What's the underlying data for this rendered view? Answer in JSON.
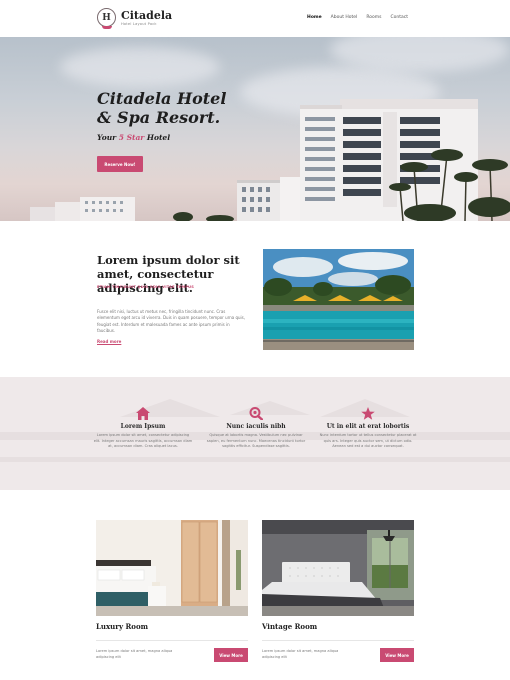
{
  "header": {
    "logo_letter": "H",
    "brand": "Citadela",
    "tagline": "Hotel Layout Pack",
    "nav": [
      "Home",
      "About Hotel",
      "Rooms",
      "Contact"
    ]
  },
  "hero": {
    "title_line1": "Citadela Hotel",
    "title_line2": "& Spa Resort.",
    "subtitle_pre": "Your ",
    "subtitle_accent": "5 Star",
    "subtitle_post": " Hotel",
    "button": "Reserve Now!"
  },
  "about": {
    "title": "Lorem ipsum dolor sit amet, consectetur adipiscing elit.",
    "kicker": "ETIAM TINCIDUNT QUIS ODIO VITAE TEMPUS",
    "body": "Fusce elit nisi, luctus ut metus nec, fringilla tincidunt nunc. Cras elementum eget arcu id viverra. Duis in quam posuere, tempor urna quis, feugiat est. Interdum et malesuada fames ac ante ipsum primis in faucibus.",
    "read_more": "Read more"
  },
  "features": [
    {
      "icon": "home-icon",
      "title": "Lorem Ipsum",
      "text": "Lorem ipsum dolor sit amet, consectetur adipiscing elit. Integer accumsan mauris sagittis, accumsan diam at, accumsan diam. Cras aliquet lacus."
    },
    {
      "icon": "search-icon",
      "title": "Nunc iaculis nibh",
      "text": "Quisque at lobortis magna. Vestibulum nec pulvinar sapien, eu fermentum nunc. Maecenas tincidunt tortor sagittis efficitur. Suspendisse sagittis."
    },
    {
      "icon": "star-icon",
      "title": "Ut in elit at erat lobortis",
      "text": "Nunc interdum tortor ut tellus consectetur placerat at quis ars. Integer quis auctor sem, ut dictum odio. Aenean sed est a dui auctor consequat."
    }
  ],
  "rooms": [
    {
      "title": "Luxury Room",
      "desc": "Lorem ipsum dolor sit amet, magna aliqua adipiscing elit",
      "button": "View More"
    },
    {
      "title": "Vintage Room",
      "desc": "Lorem ipsum dolor sit amet, magna aliqua adipiscing elit",
      "button": "View More"
    }
  ],
  "colors": {
    "accent": "#c94a72",
    "features_bg": "#efe9ea"
  }
}
